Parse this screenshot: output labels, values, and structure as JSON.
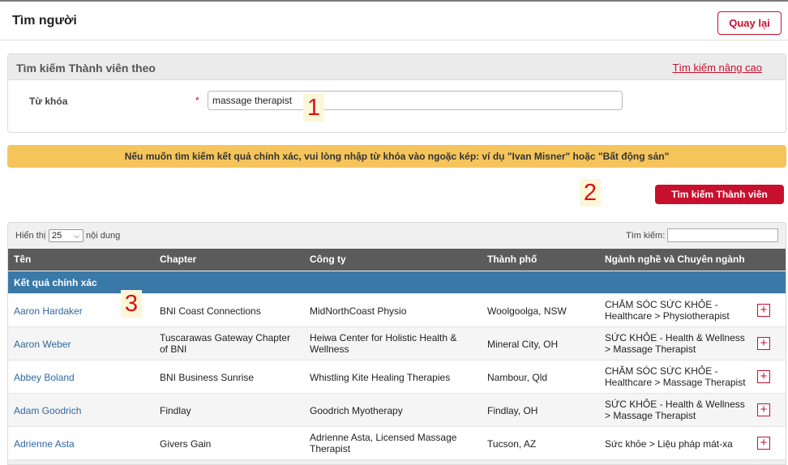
{
  "header": {
    "title": "Tìm người",
    "back_label": "Quay lại"
  },
  "search_panel": {
    "title": "Tìm kiếm Thành viên theo",
    "advanced_link": "Tìm kiếm nâng cao",
    "keyword_label": "Từ khóa",
    "required_mark": "*",
    "keyword_value": "massage therapist"
  },
  "notice": "Nếu muốn tìm kiếm kết quả chính xác, vui lòng nhập từ khóa vào ngoặc kép: ví dụ \"Ivan Misner\" hoặc \"Bất động sản\"",
  "search_button": "Tìm kiếm Thành viên",
  "markers": [
    "1",
    "2",
    "3"
  ],
  "results": {
    "show_label": "Hiển thị",
    "page_size": "25",
    "content_label": "nội dung",
    "filter_label": "Tìm kiếm:",
    "columns": [
      "Tên",
      "Chapter",
      "Công ty",
      "Thành phố",
      "Ngành nghề và Chuyên ngành"
    ],
    "group_label": "Kết quả chính xác",
    "rows": [
      {
        "name": "Aaron Hardaker",
        "chapter": "BNI Coast Connections",
        "company": "MidNorthCoast Physio",
        "city": "Woolgoolga, NSW",
        "industry": "CHĂM SÓC SỨC KHỎE - Healthcare > Physiotherapist"
      },
      {
        "name": "Aaron Weber",
        "chapter": "Tuscarawas Gateway Chapter of BNI",
        "company": "Heiwa Center for Holistic Health & Wellness",
        "city": "Mineral City, OH",
        "industry": "SỨC KHỎE - Health & Wellness > Massage Therapist"
      },
      {
        "name": "Abbey Boland",
        "chapter": "BNI Business Sunrise",
        "company": "Whistling Kite Healing Therapies",
        "city": "Nambour, Qld",
        "industry": "CHĂM SÓC SỨC KHỎE - Healthcare > Massage Therapist"
      },
      {
        "name": "Adam Goodrich",
        "chapter": "Findlay",
        "company": "Goodrich Myotherapy",
        "city": "Findlay, OH",
        "industry": "SỨC KHỎE - Health & Wellness > Massage Therapist"
      },
      {
        "name": "Adrienne Asta",
        "chapter": "Givers Gain",
        "company": "Adrienne Asta, Licensed Massage Therapist",
        "city": "Tucson, AZ",
        "industry": "Sức khỏe > Liệu pháp mát-xa"
      }
    ]
  }
}
